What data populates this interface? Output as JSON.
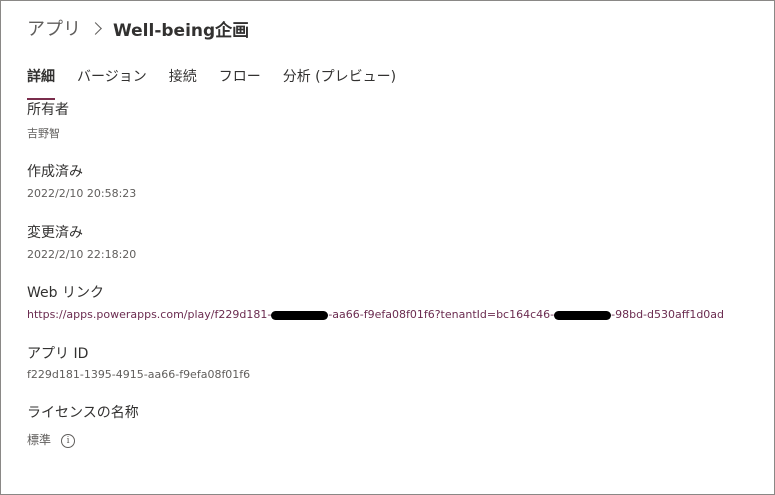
{
  "breadcrumb": {
    "root": "アプリ",
    "current": "Well-being企画"
  },
  "tabs": [
    {
      "label": "詳細",
      "active": true
    },
    {
      "label": "バージョン",
      "active": false
    },
    {
      "label": "接続",
      "active": false
    },
    {
      "label": "フロー",
      "active": false
    },
    {
      "label": "分析 (プレビュー)",
      "active": false
    }
  ],
  "details": {
    "owner": {
      "label": "所有者",
      "value": "吉野智"
    },
    "created": {
      "label": "作成済み",
      "value": "2022/2/10 20:58:23"
    },
    "modified": {
      "label": "変更済み",
      "value": "2022/2/10 22:18:20"
    },
    "web_link": {
      "label": "Web リンク",
      "part1": "https://apps.powerapps.com/play/f229d181-",
      "part2": "-aa66-f9efa08f01f6?tenantId=bc164c46-",
      "part3": "-98bd-d530aff1d0ad"
    },
    "app_id": {
      "label": "アプリ ID",
      "value": "f229d181-1395-4915-aa66-f9efa08f01f6"
    },
    "license": {
      "label": "ライセンスの名称",
      "value": "標準",
      "info_icon": "info-icon"
    }
  },
  "colors": {
    "accent": "#7a2d4c",
    "link": "#6b2c50",
    "text": "#323130",
    "secondary": "#605e5c",
    "border": "#8a8886"
  }
}
